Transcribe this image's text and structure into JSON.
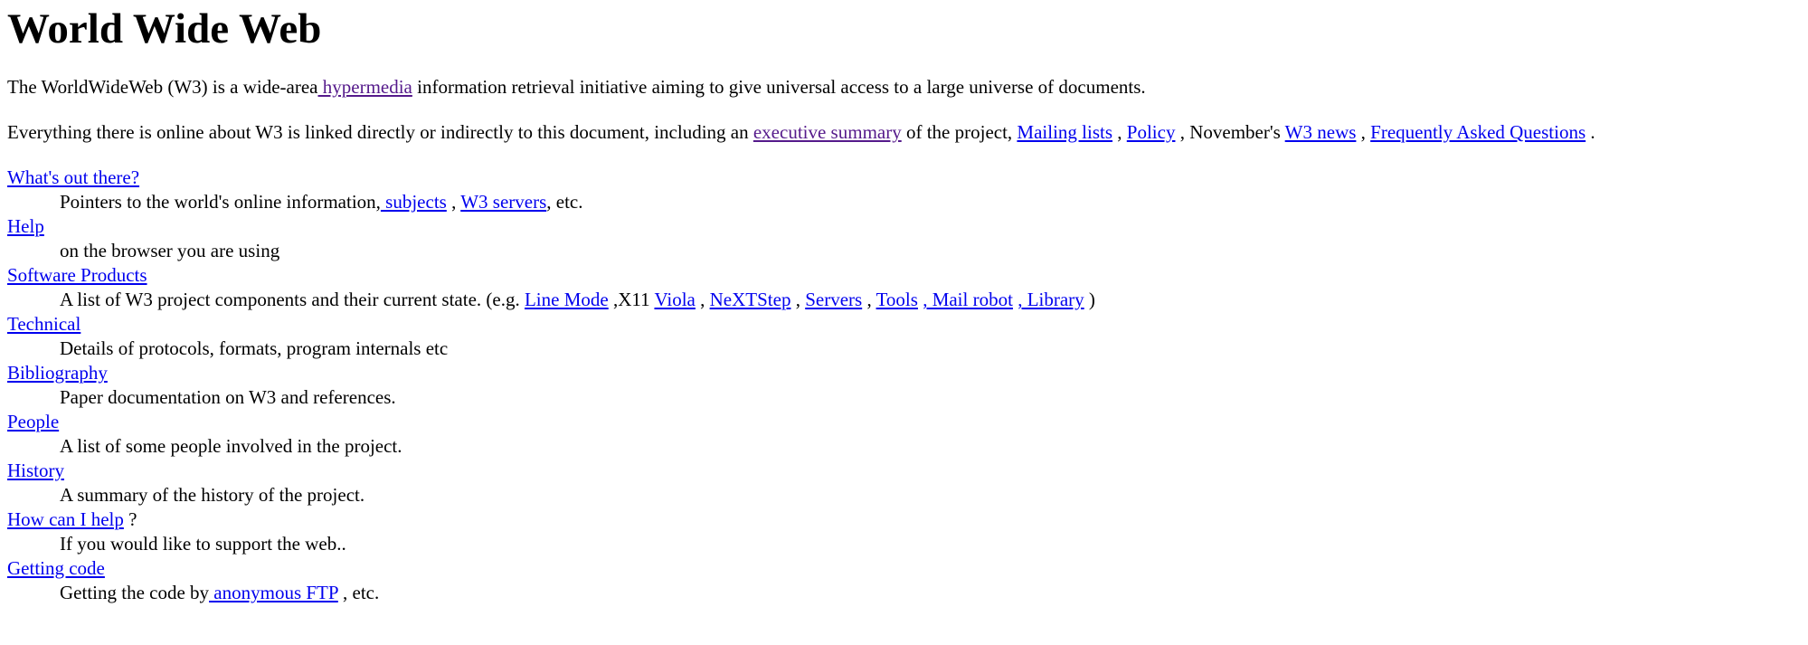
{
  "title": "World Wide Web",
  "colors": {
    "link": "#0000ee",
    "visited_link": "#551a8b",
    "text": "#000000",
    "background": "#ffffff"
  },
  "intro": {
    "text_before": "The WorldWideWeb (W3) is a wide-area",
    "link_hypermedia": " hypermedia",
    "text_after": " information retrieval initiative aiming to give universal access to a large universe of documents."
  },
  "summary": {
    "text_before": "Everything there is online about W3 is linked directly or indirectly to this document, including an ",
    "link_executive_summary": "executive summary",
    "text_project": " of the project, ",
    "link_mailing_lists": "Mailing lists",
    "sep1": " , ",
    "link_policy": "Policy",
    "text_novembers": " , November's ",
    "link_w3_news": "W3 news",
    "sep2": " , ",
    "link_faq": "Frequently Asked Questions",
    "text_end": " ."
  },
  "list": {
    "whats_out": {
      "term": "What's out there?",
      "desc_before": "Pointers to the world's online information,",
      "link_subjects": " subjects",
      "sep": " , ",
      "link_w3_servers": "W3 servers",
      "desc_after": ", etc."
    },
    "help": {
      "term": "Help",
      "desc": "on the browser you are using"
    },
    "software": {
      "term": "Software Products",
      "desc_before": "A list of W3 project components and their current state. (e.g. ",
      "link_line_mode": "Line Mode",
      "text_x11": " ,X11 ",
      "link_viola": "Viola",
      "sep1": " , ",
      "link_nextstep": "NeXTStep",
      "sep2": " , ",
      "link_servers": "Servers",
      "sep3": " , ",
      "link_tools": "Tools",
      "sep4": " ",
      "link_mail_robot": ", Mail robot",
      "sep5": " ",
      "link_library": ", Library",
      "desc_after": " )"
    },
    "technical": {
      "term": "Technical",
      "desc": "Details of protocols, formats, program internals etc"
    },
    "bibliography": {
      "term": "Bibliography",
      "desc": "Paper documentation on W3 and references."
    },
    "people": {
      "term": "People",
      "desc": "A list of some people involved in the project."
    },
    "history": {
      "term": "History",
      "desc": "A summary of the history of the project."
    },
    "how_can_i_help": {
      "term": "How can I help",
      "term_suffix": " ?",
      "desc": "If you would like to support the web.."
    },
    "getting_code": {
      "term": "Getting code",
      "desc_before": "Getting the code by",
      "link_ftp": " anonymous FTP",
      "desc_after": " , etc."
    }
  }
}
